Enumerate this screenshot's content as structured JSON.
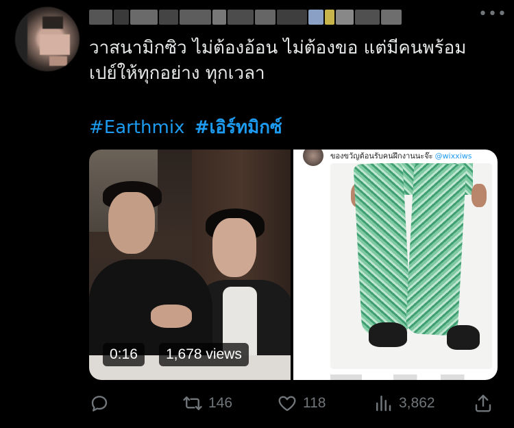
{
  "post": {
    "text": "วาสนามิกซิว ไม่ต้องอ้อน ไม่ต้องขอ แต่มีคนพร้อม\nเปย์ให้ทุกอย่าง ทุกเวลา",
    "hashtags": [
      "#Earthmix",
      "#เอิร์ทมิกซ์"
    ]
  },
  "media": {
    "video": {
      "duration": "0:16",
      "views": "1,678 views"
    },
    "screenshot": {
      "caption": "ของขวัญต้อนรับคนฝึกงานนะจ๊ะ",
      "handle": "@wixxiws"
    }
  },
  "actions": {
    "reply_count": "",
    "retweet_count": "146",
    "like_count": "118",
    "view_count": "3,862"
  },
  "colors": {
    "background": "#000000",
    "text": "#e7e9ea",
    "muted": "#71767b",
    "link": "#1d9bf0"
  },
  "icons": {
    "more": "more-icon",
    "reply": "reply-icon",
    "retweet": "retweet-icon",
    "like": "heart-icon",
    "views": "views-icon",
    "share": "share-icon"
  }
}
